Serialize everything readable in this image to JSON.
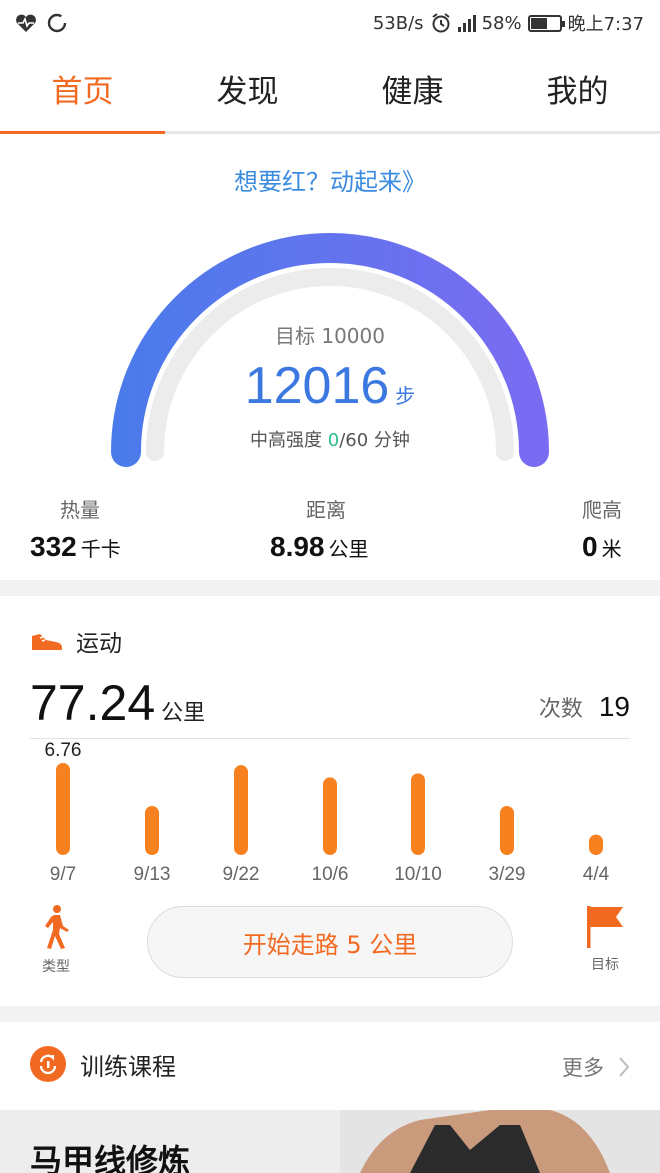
{
  "status_bar": {
    "network_speed": "53B/s",
    "battery_percent": "58%",
    "battery_level": 0.58,
    "time": "晚上7:37"
  },
  "tabs": [
    {
      "label": "首页",
      "active": true
    },
    {
      "label": "发现",
      "active": false
    },
    {
      "label": "健康",
      "active": false
    },
    {
      "label": "我的",
      "active": false
    }
  ],
  "summary": {
    "promo": "想要红？动起来》",
    "goal": "目标 10000",
    "steps": "12016",
    "steps_unit": "步",
    "intensity_prefix": "中高强度 ",
    "intensity_value": "0",
    "intensity_suffix": "/60 分钟",
    "metrics": {
      "calories": {
        "label": "热量",
        "value": "332",
        "unit": "千卡"
      },
      "distance": {
        "label": "距离",
        "value": "8.98",
        "unit": "公里"
      },
      "climb": {
        "label": "爬高",
        "value": "0",
        "unit": "米"
      }
    }
  },
  "sport": {
    "title": "运动",
    "total_distance": "77.24",
    "distance_unit": "公里",
    "count_label": "次数",
    "count_value": "19",
    "type_label": "类型",
    "goal_label": "目标",
    "start_button": "开始走路 5 公里"
  },
  "chart_data": {
    "type": "bar",
    "categories": [
      "9/7",
      "9/13",
      "9/22",
      "10/6",
      "10/10",
      "3/29",
      "4/4"
    ],
    "values": [
      6.76,
      3.6,
      6.6,
      5.7,
      6.0,
      3.6,
      1.5
    ],
    "data_labels": [
      "6.76",
      "",
      "",
      "",
      "",
      "",
      ""
    ],
    "bar_color": "#f7811f",
    "ylim": [
      0,
      6.76
    ]
  },
  "training": {
    "title": "训练课程",
    "more": "更多",
    "banner_title": "马甲线修炼"
  },
  "colors": {
    "accent": "#f26a21",
    "gauge_start": "#4b7bea",
    "gauge_end": "#7a6cf2",
    "link_blue": "#3b8be0"
  }
}
